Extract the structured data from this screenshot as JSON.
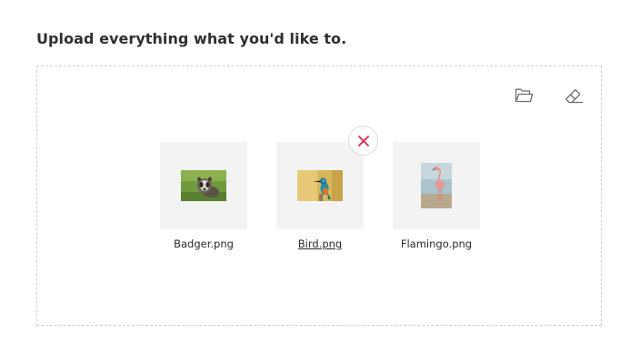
{
  "heading": "Upload everything what you'd like to.",
  "toolbar": {
    "open_icon": "folder-open-icon",
    "clear_icon": "eraser-icon"
  },
  "files": [
    {
      "name": "Badger.png",
      "icon": "badger-thumbnail"
    },
    {
      "name": "Bird.png",
      "icon": "kingfisher-thumbnail"
    },
    {
      "name": "Flamingo.png",
      "icon": "flamingo-thumbnail"
    }
  ],
  "remove_icon": "close-icon",
  "colors": {
    "remove_accent": "#e0264a",
    "tile_bg": "#f3f3f3",
    "border": "#cfcfcf"
  }
}
